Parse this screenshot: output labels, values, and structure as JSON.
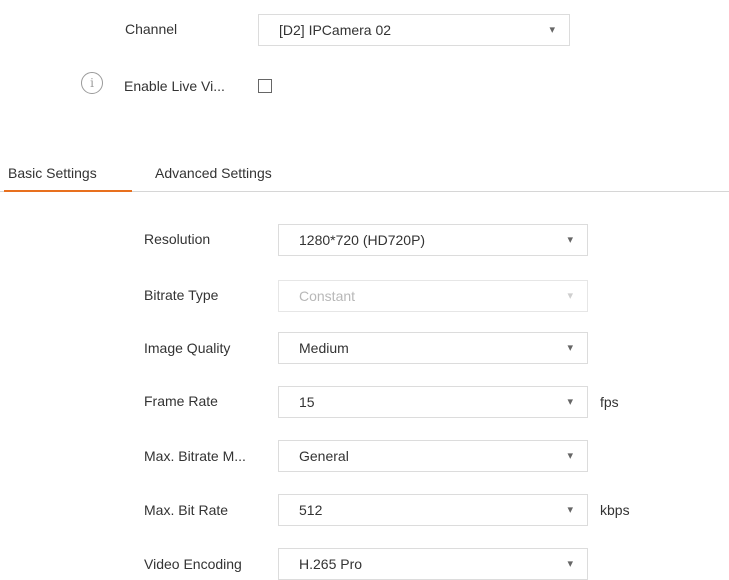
{
  "channel": {
    "label": "Channel",
    "value": "[D2] IPCamera 02"
  },
  "live_view": {
    "label": "Enable Live Vi...",
    "checked": false
  },
  "tabs": [
    {
      "label": "Basic Settings",
      "active": true
    },
    {
      "label": "Advanced Settings",
      "active": false
    }
  ],
  "fields": [
    {
      "label": "Resolution",
      "value": "1280*720 (HD720P)",
      "unit": "",
      "disabled": false
    },
    {
      "label": "Bitrate Type",
      "value": "Constant",
      "unit": "",
      "disabled": true
    },
    {
      "label": "Image Quality",
      "value": "Medium",
      "unit": "",
      "disabled": false
    },
    {
      "label": "Frame Rate",
      "value": "15",
      "unit": "fps",
      "disabled": false
    },
    {
      "label": "Max. Bitrate M...",
      "value": "General",
      "unit": "",
      "disabled": false
    },
    {
      "label": "Max. Bit Rate",
      "value": "512",
      "unit": "kbps",
      "disabled": false
    },
    {
      "label": "Video Encoding",
      "value": "H.265 Pro",
      "unit": "",
      "disabled": false
    }
  ],
  "colors": {
    "accent": "#e8701e",
    "border": "#dcdcdc",
    "disabled_text": "#b8b8b8"
  },
  "icons": {
    "caret": "chevron-down-icon",
    "info": "info-icon"
  }
}
